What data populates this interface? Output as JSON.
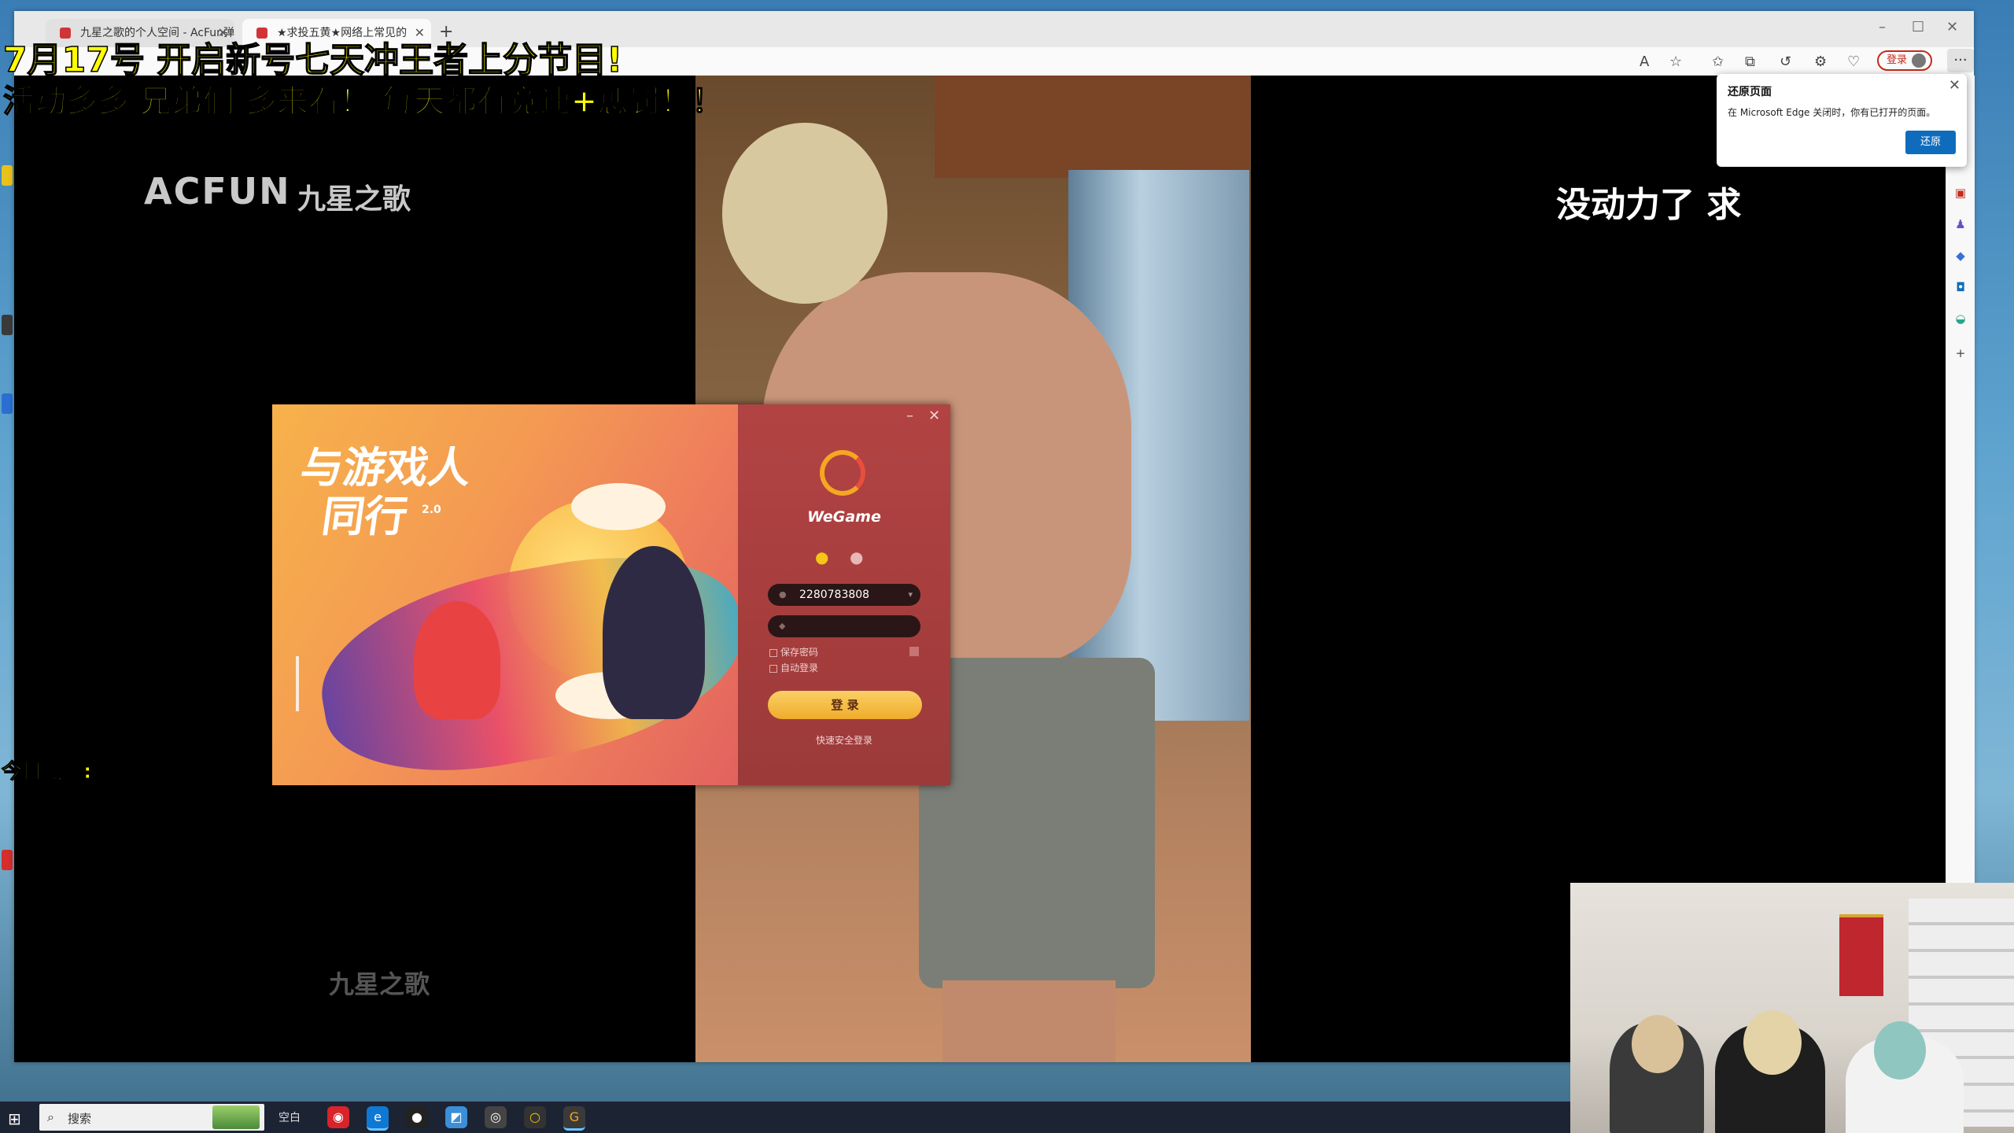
{
  "browser": {
    "tabs": [
      {
        "label": "九星之歌的个人空间 - AcFun弹幕"
      },
      {
        "label": "★求投五黄★网络上常见的"
      }
    ],
    "new_tab": "+",
    "login_label": "登录",
    "more_label": "···"
  },
  "overlay": {
    "banner_line1": "7月17号 开启新号七天冲王者上分节目!",
    "banner_line2": "活动多多 兄弟们 多来看！ 每天都有竞速+惩罚！！",
    "stats_label": "今日战绩:",
    "right_text": "没动力了 求"
  },
  "video": {
    "logo": "ACFUN",
    "channel": "九星之歌",
    "bottom_watermark": "九星之歌"
  },
  "restore_popup": {
    "title": "还原页面",
    "message": "在 Microsoft Edge 关闭时，你有已打开的页面。",
    "button": "还原",
    "close": "✕"
  },
  "wegame": {
    "slogan_line1": "与游戏人",
    "slogan_line2": "同行",
    "version": "2.0",
    "brand": "WeGame",
    "account": "2280783808",
    "password": "",
    "save_password": "保存密码",
    "auto_login": "自动登录",
    "login_button": "登 录",
    "quick_login": "快速安全登录",
    "minimize": "–",
    "close": "✕"
  },
  "taskbar": {
    "search_placeholder": "搜索",
    "empty_label": "空白"
  },
  "colors": {
    "overlay_yellow": "#ffff00",
    "wegame_red": "#b24343",
    "wegame_gold": "#f0ac2c",
    "edge_blue": "#0f6cbd"
  }
}
